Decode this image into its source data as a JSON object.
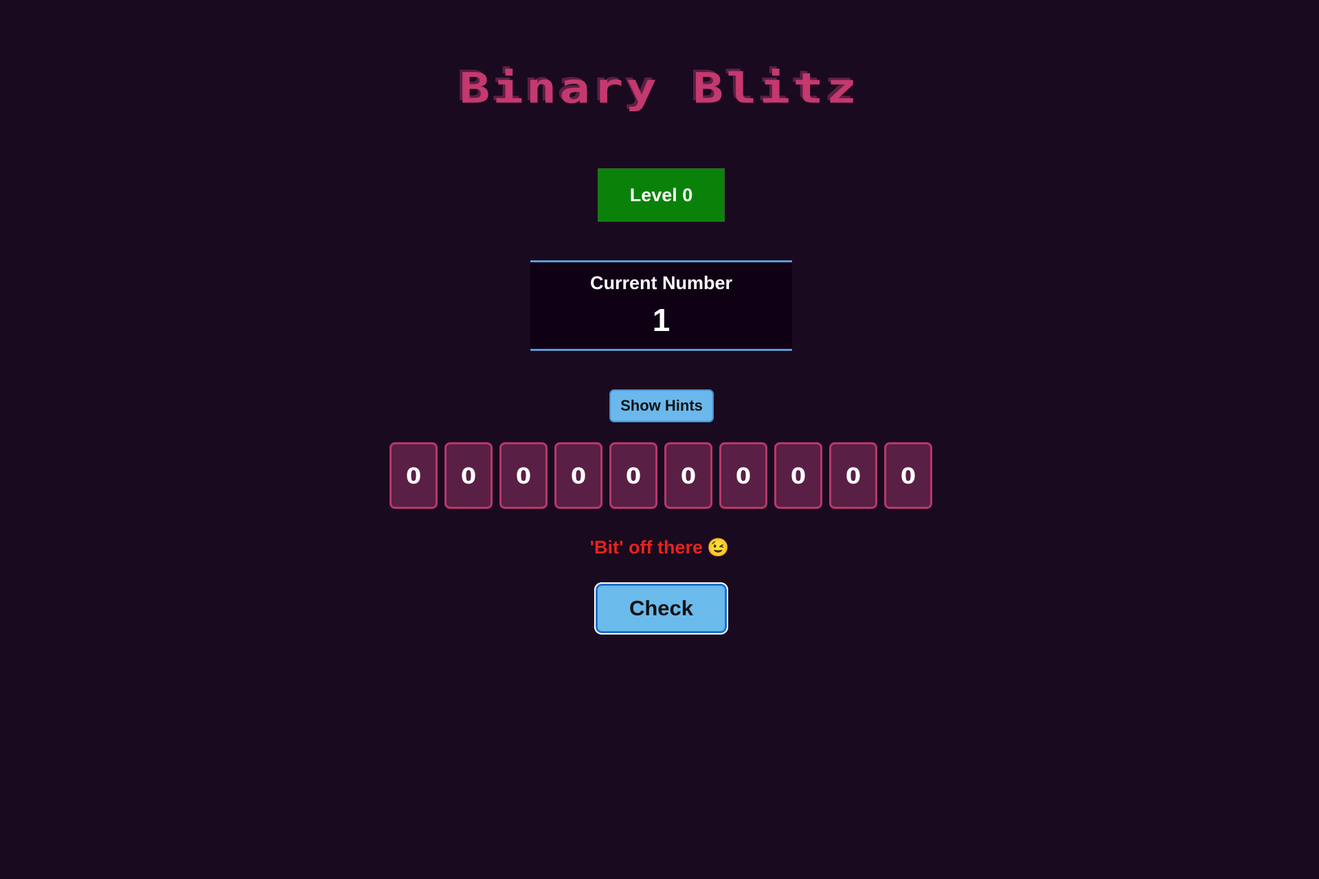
{
  "game": {
    "title": "Binary Blitz",
    "level_label": "Level 0",
    "level": 0
  },
  "current_number": {
    "label": "Current Number",
    "value": "1"
  },
  "hints_button": {
    "label": "Show Hints"
  },
  "bits": [
    "0",
    "0",
    "0",
    "0",
    "0",
    "0",
    "0",
    "0",
    "0",
    "0"
  ],
  "feedback": {
    "text": "'Bit' off there",
    "emoji": "😉",
    "emoji_name": "winking-face-icon",
    "color": "#e8221e"
  },
  "check_button": {
    "label": "Check"
  },
  "colors": {
    "background": "#1a0a1f",
    "title": "#c4396f",
    "level_badge": "#0a820a",
    "bit_card_bg": "#5a1f45",
    "bit_card_border": "#b8386a",
    "button_blue": "#6ab8ec",
    "number_border": "#5b9bd5"
  }
}
